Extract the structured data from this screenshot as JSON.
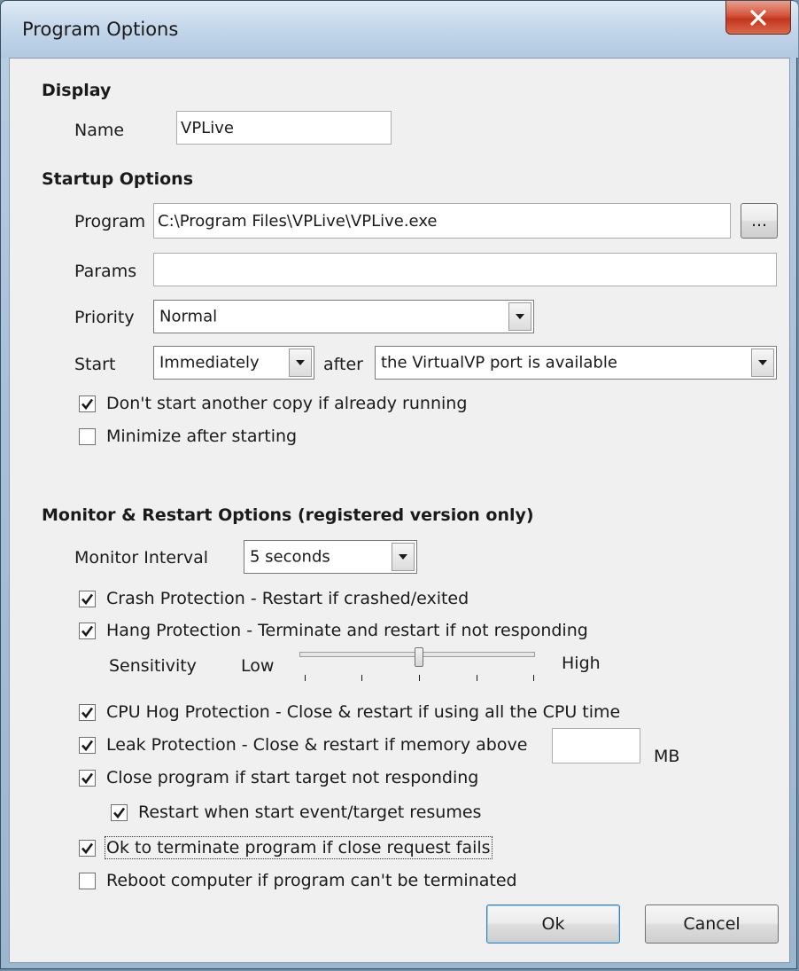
{
  "window": {
    "title": "Program Options",
    "close_icon": "close-icon"
  },
  "display": {
    "heading": "Display",
    "name_label": "Name",
    "name_value": "VPLive"
  },
  "startup": {
    "heading": "Startup Options",
    "program_label": "Program",
    "program_value": "C:\\Program Files\\VPLive\\VPLive.exe",
    "browse_label": "...",
    "params_label": "Params",
    "params_value": "",
    "priority_label": "Priority",
    "priority_value": "Normal",
    "start_label": "Start",
    "start_when_value": "Immediately",
    "after_label": "after",
    "start_condition_value": "the VirtualVP port is available",
    "dont_start_copy": {
      "label": "Don't start another copy if already running",
      "checked": true
    },
    "minimize_after": {
      "label": "Minimize after starting",
      "checked": false
    }
  },
  "monitor": {
    "heading": "Monitor & Restart Options (registered version only)",
    "interval_label": "Monitor Interval",
    "interval_value": "5 seconds",
    "crash_protection": {
      "label": "Crash Protection - Restart if crashed/exited",
      "checked": true
    },
    "hang_protection": {
      "label": "Hang Protection - Terminate and restart if not responding",
      "checked": true
    },
    "sensitivity_label": "Sensitivity",
    "sensitivity_low": "Low",
    "sensitivity_high": "High",
    "sensitivity_level": 0.5,
    "cpu_hog": {
      "label": "CPU Hog Protection - Close & restart if using all the CPU time",
      "checked": true
    },
    "leak_protection": {
      "label": "Leak Protection - Close & restart if memory above",
      "checked": true
    },
    "leak_mb_value": "",
    "leak_unit": "MB",
    "close_if_target": {
      "label": "Close program if start target not responding",
      "checked": true
    },
    "restart_when_resumes": {
      "label": "Restart when start event/target resumes",
      "checked": true
    },
    "ok_to_terminate": {
      "label": "Ok to terminate program if close request fails",
      "checked": true
    },
    "reboot_computer": {
      "label": "Reboot computer if program can't be terminated",
      "checked": false
    }
  },
  "buttons": {
    "ok": "Ok",
    "cancel": "Cancel"
  }
}
